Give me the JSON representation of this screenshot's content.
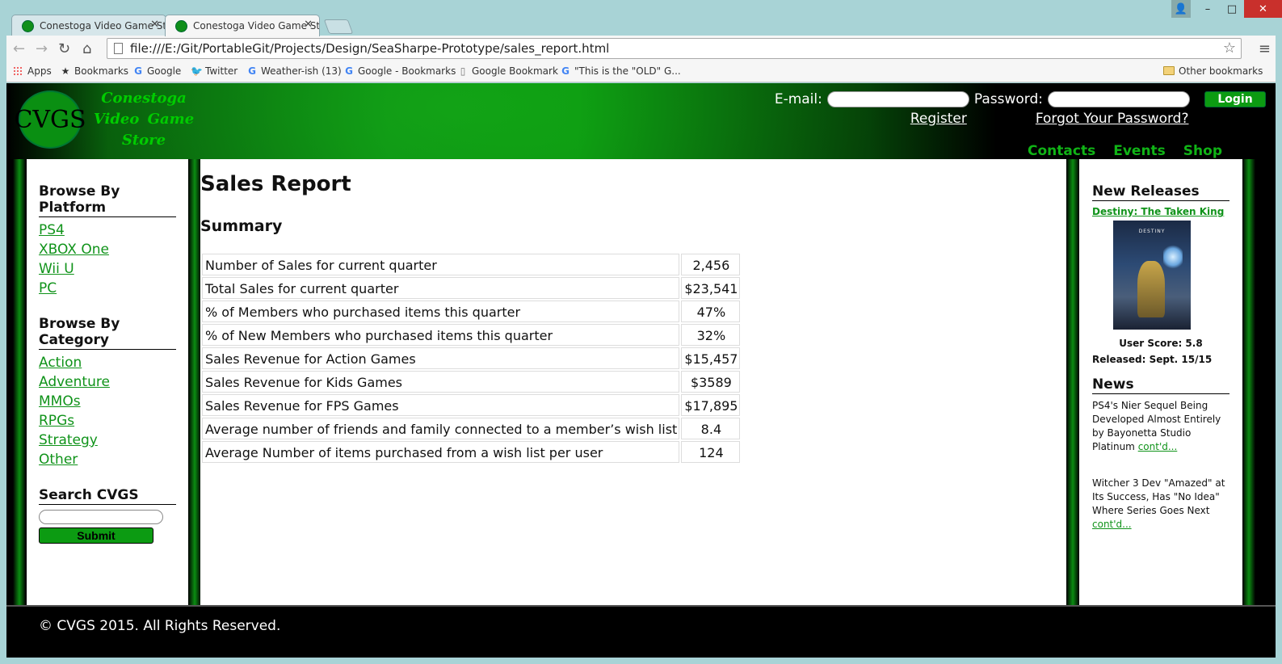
{
  "browser": {
    "tabs": [
      {
        "title": "Conestoga Video Game St",
        "active": false
      },
      {
        "title": "Conestoga Video Game St",
        "active": true
      }
    ],
    "url": "file:///E:/Git/PortableGit/Projects/Design/SeaSharpe-Prototype/sales_report.html",
    "bookmarks": [
      "Apps",
      "Bookmarks",
      "Google",
      "Twitter",
      "Weather-ish (13)",
      "Google - Bookmarks",
      "Google Bookmark",
      "\"This is the \"OLD\" G..."
    ],
    "other_bookmarks": "Other bookmarks"
  },
  "header": {
    "logo_letters": "CVGS",
    "logo_lines": [
      "Conestoga",
      "Video Game",
      "Store"
    ],
    "email_label": "E-mail:",
    "password_label": "Password:",
    "login_label": "Login",
    "register_label": "Register",
    "forgot_label": "Forgot Your Password?",
    "nav": [
      "Contacts",
      "Events",
      "Shop"
    ]
  },
  "sidebar": {
    "platform_heading": "Browse By Platform",
    "platforms": [
      "PS4",
      "XBOX One",
      "Wii U",
      "PC"
    ],
    "category_heading": "Browse By Category",
    "categories": [
      "Action",
      "Adventure",
      "MMOs",
      "RPGs",
      "Strategy",
      "Other"
    ],
    "search_heading": "Search CVGS",
    "submit_label": "Submit"
  },
  "main": {
    "title": "Sales Report",
    "summary_heading": "Summary",
    "rows": [
      {
        "label": "Number of Sales for current quarter",
        "value": "2,456"
      },
      {
        "label": "Total Sales for current quarter",
        "value": "$23,541"
      },
      {
        "label": "% of Members who purchased items this quarter",
        "value": "47%"
      },
      {
        "label": "% of New Members who purchased items this quarter",
        "value": "32%"
      },
      {
        "label": "Sales Revenue for Action Games",
        "value": "$15,457"
      },
      {
        "label": "Sales Revenue for Kids Games",
        "value": "$3589"
      },
      {
        "label": "Sales Revenue for FPS Games",
        "value": "$17,895"
      },
      {
        "label": "Average number of friends and family connected to a member’s wish list",
        "value": "8.4"
      },
      {
        "label": "Average Number of items purchased from a wish list per user",
        "value": "124"
      }
    ]
  },
  "right_sidebar": {
    "new_releases_heading": "New Releases",
    "release_title": "Destiny: The Taken King",
    "cover_logo": "DESTINY",
    "user_score": "User Score: 5.8",
    "released": "Released: Sept. 15/15",
    "news_heading": "News",
    "news": [
      {
        "text": "PS4's Nier Sequel Being Developed Almost Entirely by Bayonetta Studio Platinum ",
        "link": "cont'd..."
      },
      {
        "text": "Witcher 3 Dev \"Amazed\" at Its Success, Has \"No Idea\" Where Series Goes Next ",
        "link": "cont'd..."
      }
    ]
  },
  "footer": {
    "copyright": "© CVGS 2015. All Rights Reserved."
  },
  "colors": {
    "brand_green": "#10931a",
    "button_green": "#0c9b12",
    "header_black": "#000000"
  }
}
